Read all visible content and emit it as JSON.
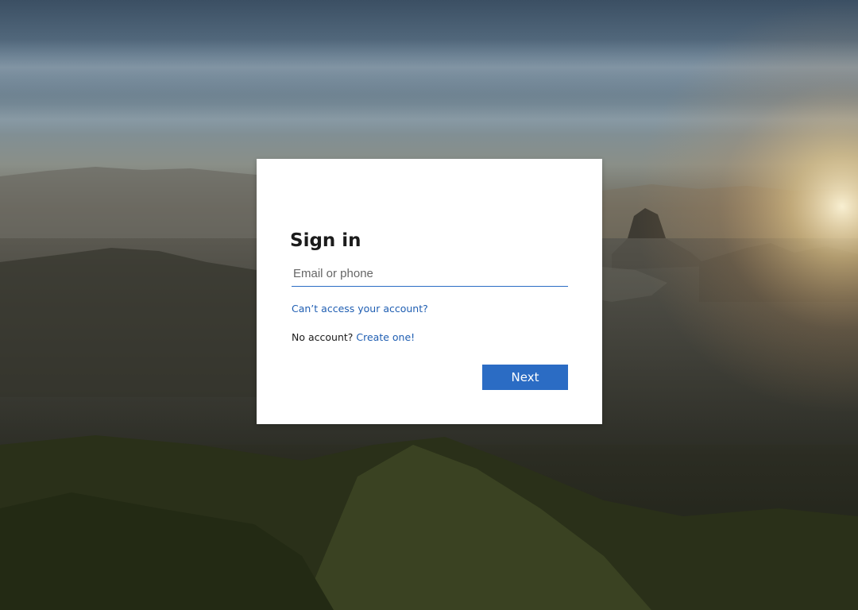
{
  "signin": {
    "title": "Sign in",
    "email_placeholder": "Email or phone",
    "email_value": "",
    "cant_access_link": "Can’t access your account?",
    "no_account_text": "No account?",
    "create_link": "Create one!",
    "next_button": "Next"
  },
  "colors": {
    "accent": "#2b6cc4",
    "link": "#1f5eb2",
    "card_background": "#ffffff",
    "text": "#1b1b1b"
  }
}
